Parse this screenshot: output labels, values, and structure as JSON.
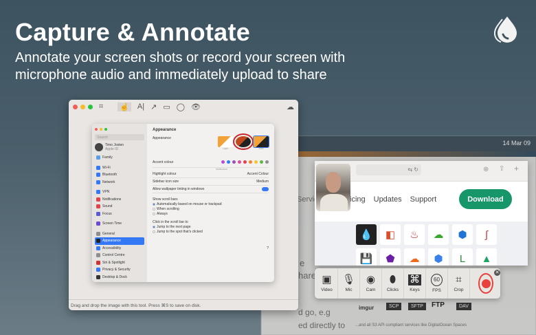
{
  "hero": {
    "title": "Capture & Annotate",
    "subtitle": "Annotate your screen shots or record your screen with microphone audio and immediately upload to share"
  },
  "logo": "droplet-logo",
  "menubar": {
    "clock": "14 Mar 09"
  },
  "editor": {
    "status": "Drag and drop the image with this tool. Press ⌘S to save on disk.",
    "tools": [
      "crop",
      "pointer",
      "text",
      "arrow",
      "rectangle",
      "circle",
      "blur",
      "upload"
    ]
  },
  "settings": {
    "search": "Search",
    "user_name": "Timo Josten",
    "user_sub": "Apple ID",
    "family": "Family",
    "sidebar": [
      "Wi-Fi",
      "Bluetooth",
      "Network",
      "VPN",
      "Notifications",
      "Sound",
      "Focus",
      "Screen Time",
      "General",
      "Appearance",
      "Accessibility",
      "Control Centre",
      "Siri & Spotlight",
      "Privacy & Security",
      "Desktop & Dock"
    ],
    "selected": "Appearance",
    "heading": "Appearance",
    "appearance_label": "Appearance",
    "modes": [
      "Light",
      "Dark",
      "Auto"
    ],
    "accent_label": "Accent colour",
    "accent_sub": "Multicolour",
    "accent_colors": [
      "#b44fd9",
      "#2f7cf6",
      "#9b4fb8",
      "#e24b9a",
      "#e0434b",
      "#f0862e",
      "#f5c431",
      "#5cb948",
      "#8e8e93"
    ],
    "highlight_label": "Highlight colour",
    "highlight_value": "Accent Colour",
    "icon_size_label": "Sidebar icon size",
    "icon_size_value": "Medium",
    "tinting_label": "Allow wallpaper tinting in windows",
    "scroll_label": "Show scroll bars",
    "scroll_opts": [
      "Automatically based on mouse or trackpad",
      "When scrolling",
      "Always"
    ],
    "click_label": "Click in the scroll bar to",
    "click_opts": [
      "Jump to the next page",
      "Jump to the spot that's clicked"
    ],
    "help": "?"
  },
  "browser": {
    "nav": [
      "Services",
      "Pricing",
      "Updates",
      "Support"
    ],
    "download": "Download"
  },
  "recorder": {
    "buttons": [
      {
        "label": "Video",
        "icon": "▣"
      },
      {
        "label": "Mic",
        "icon": "🎙"
      },
      {
        "label": "Cam",
        "icon": "◉"
      },
      {
        "label": "Clicks",
        "icon": "⬮"
      },
      {
        "label": "Keys",
        "icon": "⌘"
      },
      {
        "label": "FPS",
        "icon": "60"
      },
      {
        "label": "Crop",
        "icon": "⌗"
      }
    ]
  },
  "background_text": {
    "line1": "...and all S3 API compliant services like DigitalOcean Spaces",
    "lines": [
      "e",
      "hare",
      "d go, e.g",
      "ed directly to"
    ],
    "logos": [
      "imgur",
      "SCP",
      "SFTP",
      "FTP",
      "DAV"
    ]
  }
}
